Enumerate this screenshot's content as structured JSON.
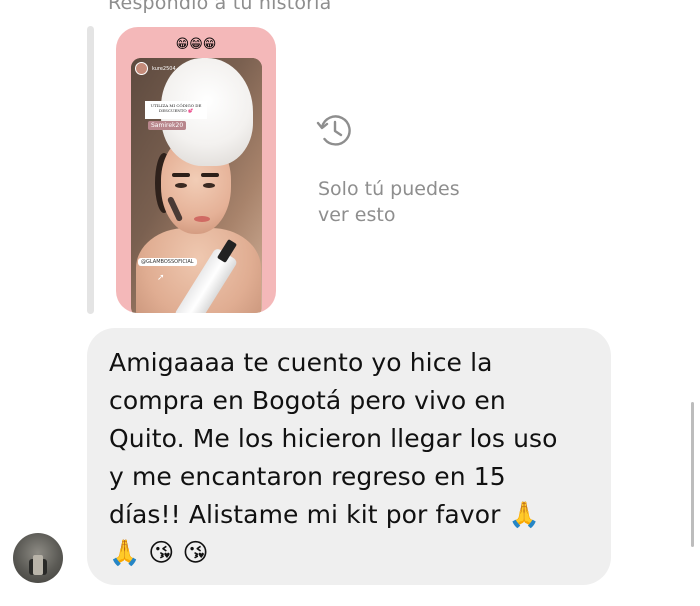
{
  "reply": {
    "header": "Respondió a tu historia",
    "story": {
      "emojis": "😁😁😁",
      "username": "kure2504",
      "promo_text": "UTILIZA MI CÓDIGO DE DESCUENTO 💕",
      "code": "Samirek20",
      "mention": "@GLAMBOSSOFICIAL"
    }
  },
  "privacy": {
    "icon": "history-icon",
    "text": "Solo tú puedes\nver esto"
  },
  "message": {
    "text": "Amigaaaa te cuento yo hice la\ncompra en Bogotá pero vivo en\nQuito. Me los hicieron llegar los uso\ny me encantaron regreso en  15\ndías!! Alistame mi kit por favor 🙏\n🙏 😘 😘",
    "sender_avatar": "avatar"
  },
  "colors": {
    "bubble": "#efefef",
    "story_frame": "#f4b8b9",
    "muted_text": "#8e8e8e"
  }
}
